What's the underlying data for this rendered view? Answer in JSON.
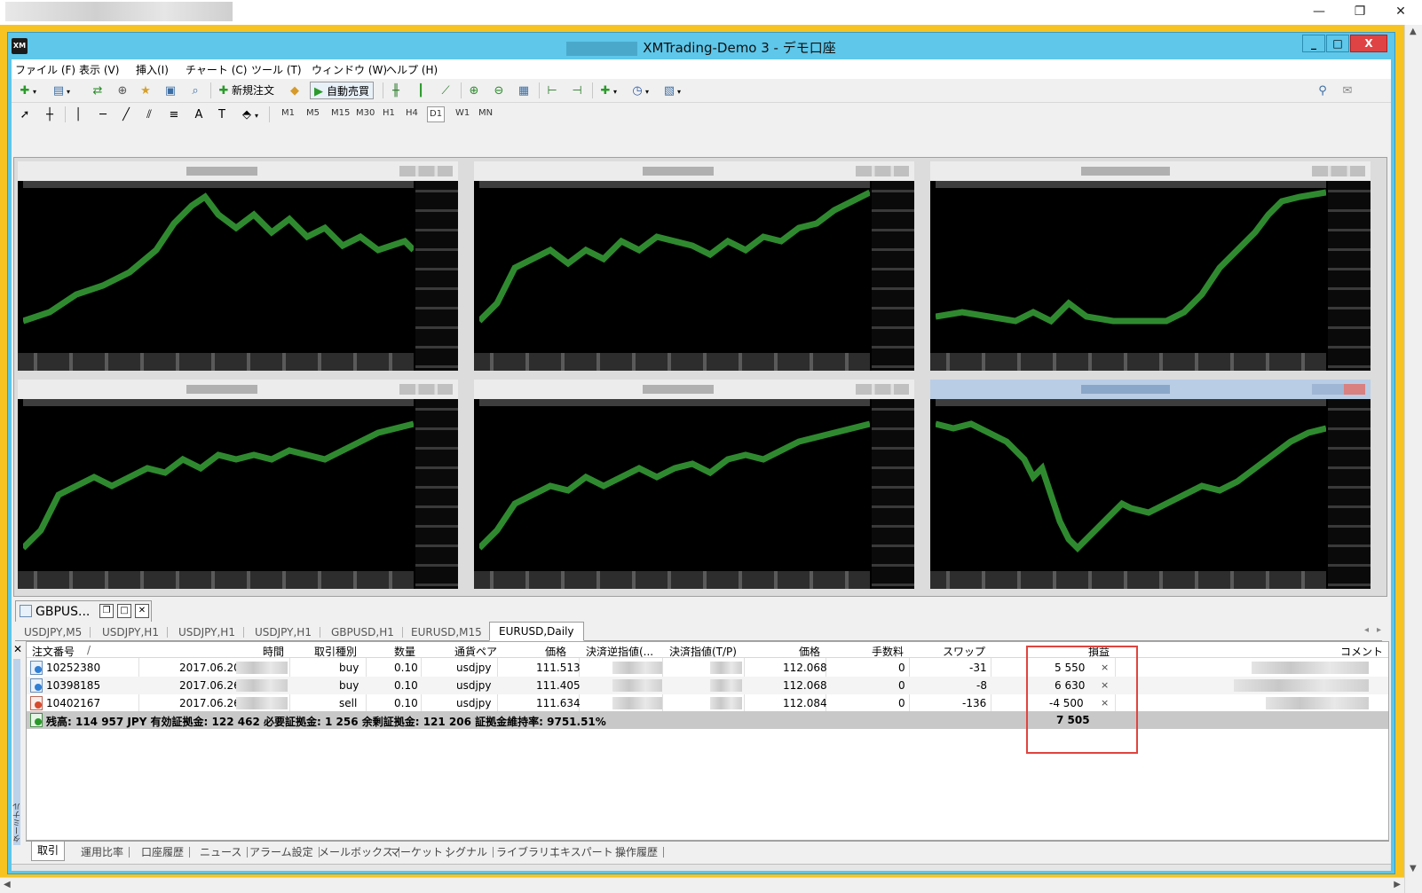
{
  "app": {
    "title": "XMTrading-Demo 3 - デモ口座",
    "icon_label": "XM",
    "controls": [
      "_",
      "□",
      "X"
    ]
  },
  "host": {
    "controls": [
      "—",
      "❐",
      "✕"
    ]
  },
  "menu": [
    "ファイル (F)",
    "表示 (V)",
    "挿入(I)",
    "チャート (C)",
    "ツール (T)",
    "ウィンドウ (W)",
    "ヘルプ (H)"
  ],
  "toolbar": {
    "new_order": "新規注文",
    "auto_trade": "自動売買"
  },
  "timeframes": [
    "M1",
    "M5",
    "M15",
    "M30",
    "H1",
    "H4",
    "D1",
    "W1",
    "MN"
  ],
  "active_timeframe": "D1",
  "terminal": {
    "window_tab": "GBPUS...",
    "vertical_label": "ターミナル",
    "chart_tabs": [
      "USDJPY,M5",
      "USDJPY,H1",
      "USDJPY,H1",
      "USDJPY,H1",
      "GBPUSD,H1",
      "EURUSD,M15",
      "EURUSD,Daily"
    ],
    "active_chart_tab": "EURUSD,Daily",
    "columns": {
      "order": "注文番号",
      "sort": "/",
      "time": "時間",
      "type": "取引種別",
      "size": "数量",
      "symbol": "通貨ペア",
      "price": "価格",
      "sl": "決済逆指値(...",
      "tp": "決済指値(T/P)",
      "price2": "価格",
      "commission": "手数料",
      "swap": "スワップ",
      "profit": "損益",
      "comment": "コメント"
    },
    "rows": [
      {
        "order": "10252380",
        "time": "2017.06.20",
        "type": "buy",
        "size": "0.10",
        "symbol": "usdjpy",
        "price": "111.513",
        "price2": "112.068",
        "commission": "0",
        "swap": "-31",
        "profit": "5 550",
        "close": "×"
      },
      {
        "order": "10398185",
        "time": "2017.06.26",
        "type": "buy",
        "size": "0.10",
        "symbol": "usdjpy",
        "price": "111.405",
        "price2": "112.068",
        "commission": "0",
        "swap": "-8",
        "profit": "6 630",
        "close": "×"
      },
      {
        "order": "10402167",
        "time": "2017.06.26",
        "type": "sell",
        "size": "0.10",
        "symbol": "usdjpy",
        "price": "111.634",
        "price2": "112.084",
        "commission": "0",
        "swap": "-136",
        "profit": "-4 500",
        "close": "×"
      }
    ],
    "summary": "残高: 114 957 JPY  有効証拠金: 122 462  必要証拠金: 1 256  余剰証拠金: 121 206  証拠金維持率: 9751.51%",
    "total_profit": "7 505",
    "bottom_tabs": [
      "取引",
      "運用比率",
      "口座履歴",
      "ニュース",
      "アラーム設定",
      "メールボックス",
      "マーケット",
      "シグナル",
      "ライブラリ",
      "エキスパート",
      "操作履歴"
    ],
    "active_bottom_tab": "取引"
  },
  "colors": {
    "accent_titlebar": "#5ec7ea",
    "host_frame": "#f6c321",
    "highlight_box": "#e0443f",
    "chart_line": "#2f8a2f",
    "buy_icon": "#2e7fd6",
    "sell_icon": "#d64a2e"
  }
}
